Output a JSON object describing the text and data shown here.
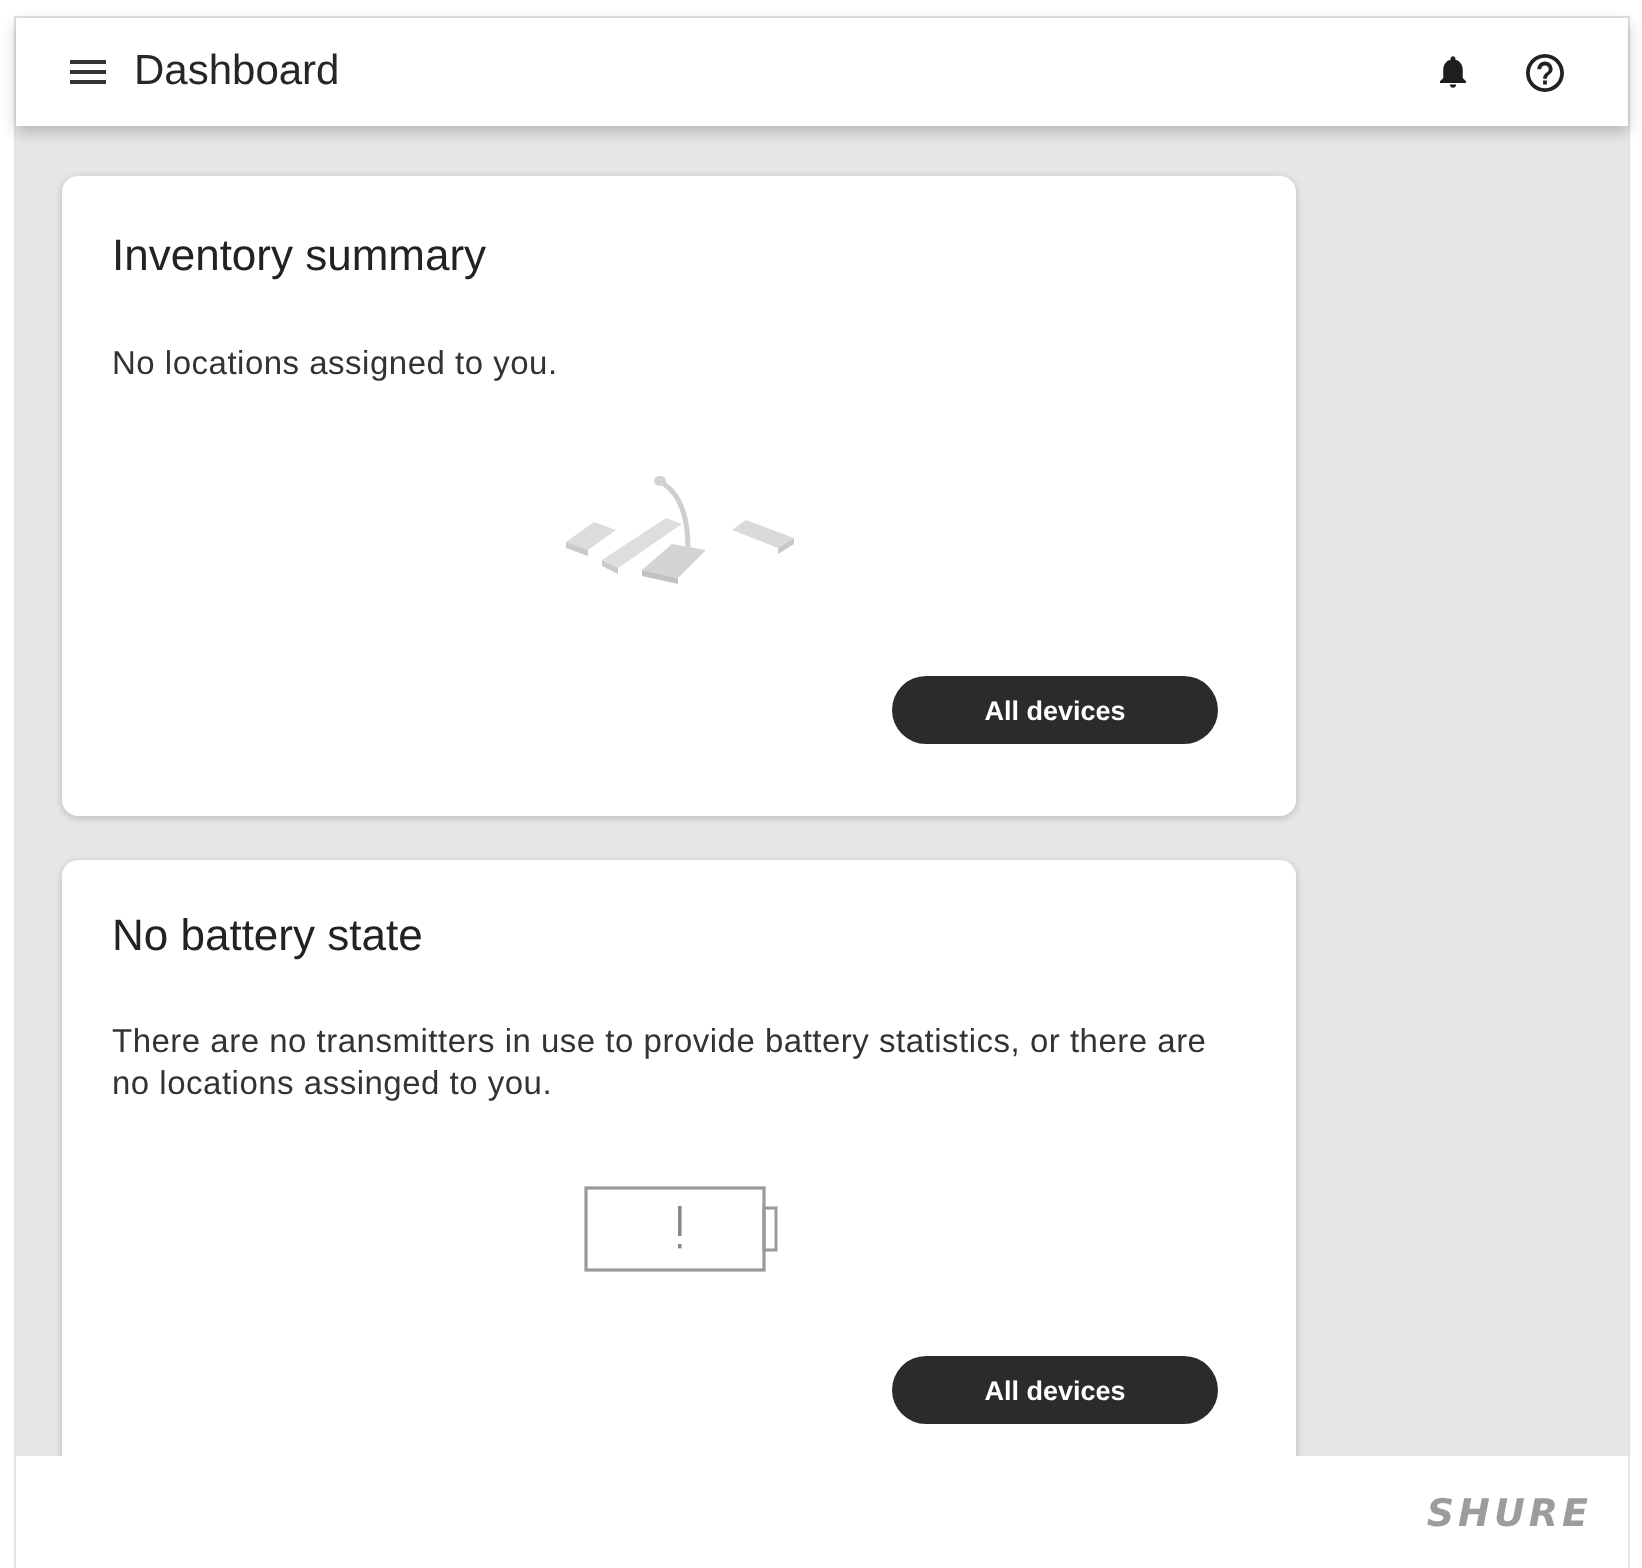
{
  "header": {
    "title": "Dashboard"
  },
  "cards": [
    {
      "kind": "inventory",
      "title": "Inventory summary",
      "message": "No locations assigned to you.",
      "button": "All devices"
    },
    {
      "kind": "battery",
      "title": "No battery state",
      "message": "There are no transmitters in use to provide battery statistics, or there are no locations assinged to you.",
      "button": "All devices"
    }
  ],
  "footer": {
    "logo": "SHURE"
  }
}
